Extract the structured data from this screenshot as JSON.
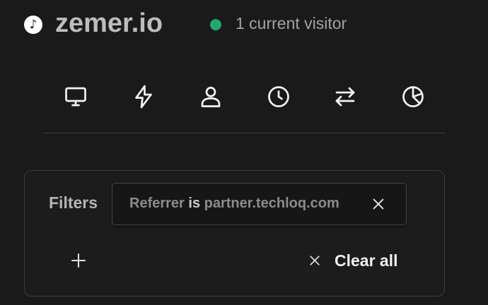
{
  "header": {
    "site_icon": "music-note-icon",
    "site_icon_glyph": "♪",
    "site_name": "zemer.io",
    "live_status_color": "#1fa971",
    "visitors_text": "1 current visitor"
  },
  "nav": {
    "items": [
      {
        "icon": "monitor-icon"
      },
      {
        "icon": "lightning-icon"
      },
      {
        "icon": "user-icon"
      },
      {
        "icon": "clock-icon"
      },
      {
        "icon": "arrows-swap-icon"
      },
      {
        "icon": "pie-chart-icon"
      }
    ]
  },
  "filters": {
    "label": "Filters",
    "active": [
      {
        "field": "Referrer",
        "operator": "is",
        "value": "partner.techloq.com"
      }
    ],
    "add_icon": "plus-icon",
    "clear_all_label": "Clear all",
    "clear_icon": "close-icon"
  }
}
